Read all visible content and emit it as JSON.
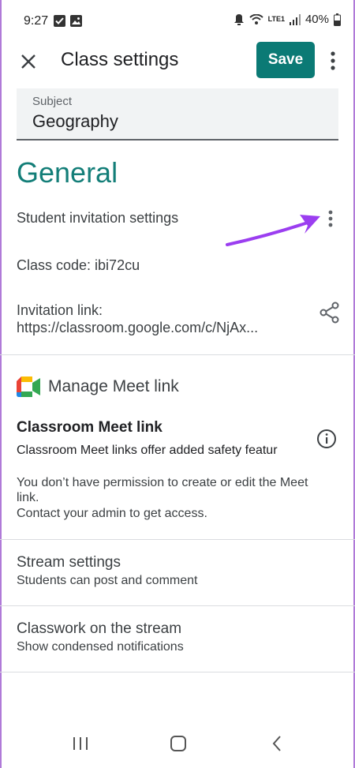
{
  "status_bar": {
    "time": "9:27",
    "battery": "40%",
    "network_label": "LTE1",
    "icons": [
      "check-square-icon",
      "image-icon",
      "alarm-icon",
      "wifi-icon",
      "signal-icon",
      "battery-icon"
    ]
  },
  "app_bar": {
    "title": "Class settings",
    "save_label": "Save",
    "accent_color": "#0b7a75"
  },
  "subject": {
    "label": "Subject",
    "value": "Geography"
  },
  "general": {
    "heading": "General",
    "student_invitation_settings": "Student invitation settings",
    "class_code": "Class code: ibi72cu",
    "invitation_link_label": "Invitation link:",
    "invitation_link_value": "https://classroom.google.com/c/NjAx..."
  },
  "meet": {
    "section_title": "Manage Meet link",
    "classroom_meet_title": "Classroom Meet link",
    "classroom_meet_desc": "Classroom Meet links offer added safety featur",
    "permission_line1": "You don’t have permission to create or edit the Meet",
    "permission_line2": "link.",
    "permission_line3": "Contact your admin to get access."
  },
  "stream_settings": {
    "title": "Stream settings",
    "subtitle": "Students can post and comment"
  },
  "classwork_stream": {
    "title": "Classwork on the stream",
    "subtitle": "Show condensed notifications"
  },
  "annotation": {
    "arrow_color": "#9b3ef0"
  }
}
